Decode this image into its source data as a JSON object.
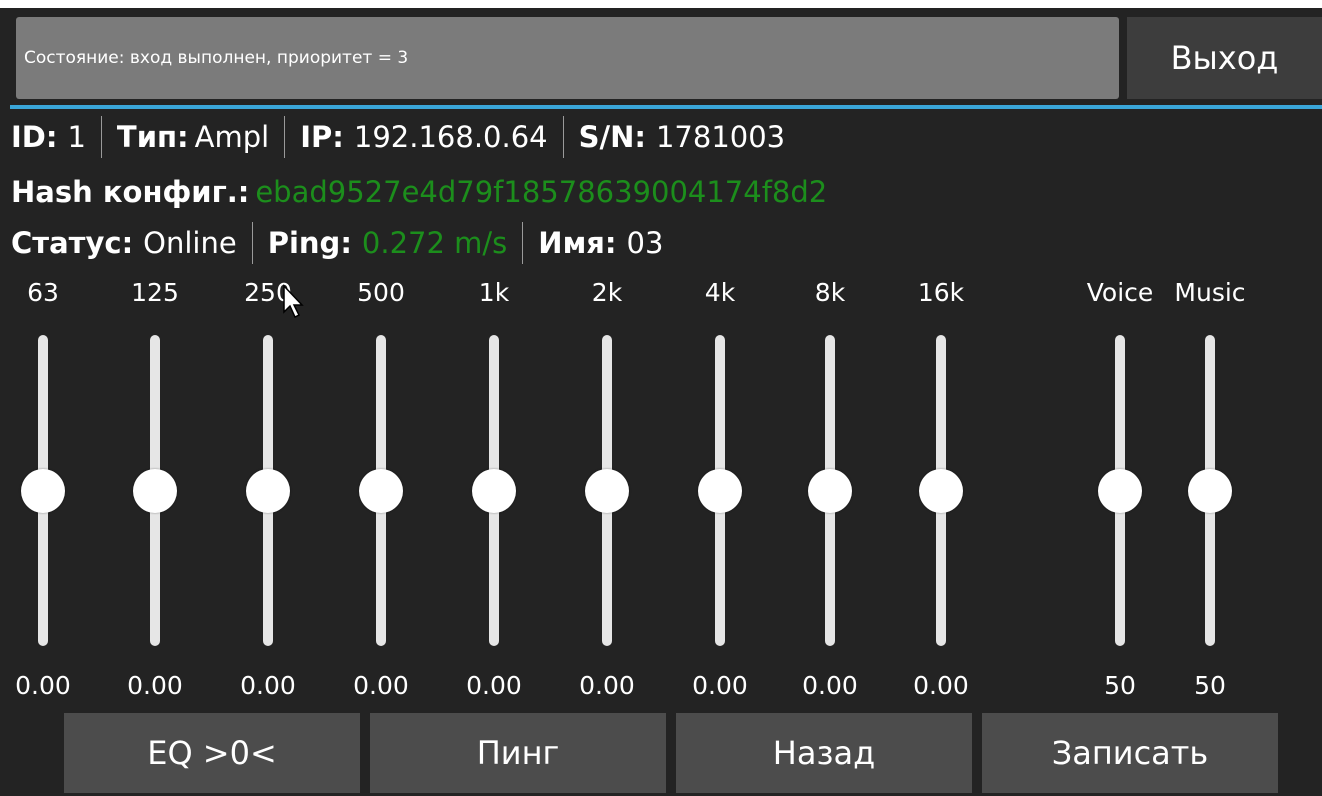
{
  "status_text": "Состояние: вход выполнен, приоритет = 3",
  "exit_label": "Выход",
  "info": {
    "id_label": "ID:",
    "id_value": "1",
    "type_label": "Тип:",
    "type_value": "Ampl",
    "ip_label": "IP:",
    "ip_value": "192.168.0.64",
    "sn_label": "S/N:",
    "sn_value": "1781003",
    "hash_label": "Hash конфиг.:",
    "hash_value": "ebad9527e4d79f18578639004174f8d2",
    "status_label": "Статус:",
    "status_value": "Online",
    "ping_label": "Ping:",
    "ping_value": "0.272 m/s",
    "name_label": "Имя:",
    "name_value": "03"
  },
  "colors": {
    "accent": "#3aa6d9",
    "green": "#1c8e1c",
    "status_box": "#7b7b7b"
  },
  "sliders": [
    {
      "label": "63",
      "value": "0.00",
      "level": 0.5
    },
    {
      "label": "125",
      "value": "0.00",
      "level": 0.5
    },
    {
      "label": "250",
      "value": "0.00",
      "level": 0.5
    },
    {
      "label": "500",
      "value": "0.00",
      "level": 0.5
    },
    {
      "label": "1k",
      "value": "0.00",
      "level": 0.5
    },
    {
      "label": "2k",
      "value": "0.00",
      "level": 0.5
    },
    {
      "label": "4k",
      "value": "0.00",
      "level": 0.5
    },
    {
      "label": "8k",
      "value": "0.00",
      "level": 0.5
    },
    {
      "label": "16k",
      "value": "0.00",
      "level": 0.5
    },
    {
      "label": "Voice",
      "value": "50",
      "level": 0.5
    },
    {
      "label": "Music",
      "value": "50",
      "level": 0.5
    }
  ],
  "buttons": {
    "eq_reset": "EQ >0<",
    "ping": "Пинг",
    "back": "Назад",
    "write": "Записать"
  }
}
